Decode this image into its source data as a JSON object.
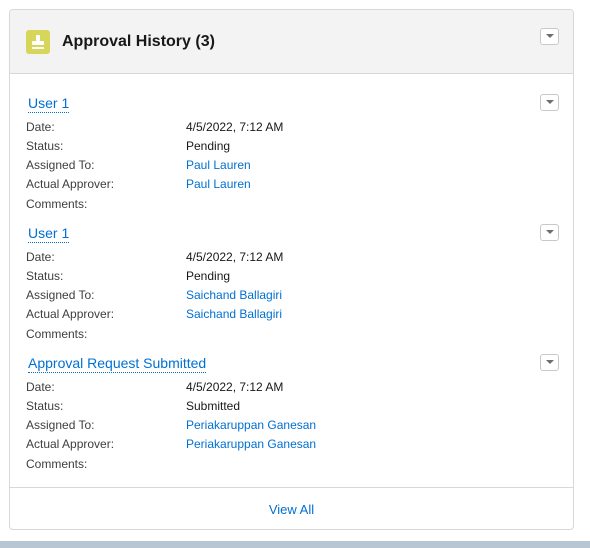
{
  "header": {
    "title": "Approval History (3)",
    "icon": "approval-stamp-icon",
    "icon_bg": "#d6d65a"
  },
  "labels": {
    "date": "Date:",
    "status": "Status:",
    "assigned_to": "Assigned To:",
    "actual_approver": "Actual Approver:",
    "comments": "Comments:"
  },
  "items": [
    {
      "title": "User 1",
      "date": "4/5/2022, 7:12 AM",
      "status": "Pending",
      "assigned_to": "Paul Lauren",
      "actual_approver": "Paul Lauren",
      "comments": ""
    },
    {
      "title": "User 1",
      "date": "4/5/2022, 7:12 AM",
      "status": "Pending",
      "assigned_to": "Saichand Ballagiri",
      "actual_approver": "Saichand Ballagiri",
      "comments": ""
    },
    {
      "title": "Approval Request Submitted",
      "date": "4/5/2022, 7:12 AM",
      "status": "Submitted",
      "assigned_to": "Periakaruppan Ganesan",
      "actual_approver": "Periakaruppan Ganesan",
      "comments": ""
    }
  ],
  "footer": {
    "view_all_label": "View All"
  },
  "colors": {
    "link": "#0070d2",
    "header_bg": "#f3f3f3"
  }
}
